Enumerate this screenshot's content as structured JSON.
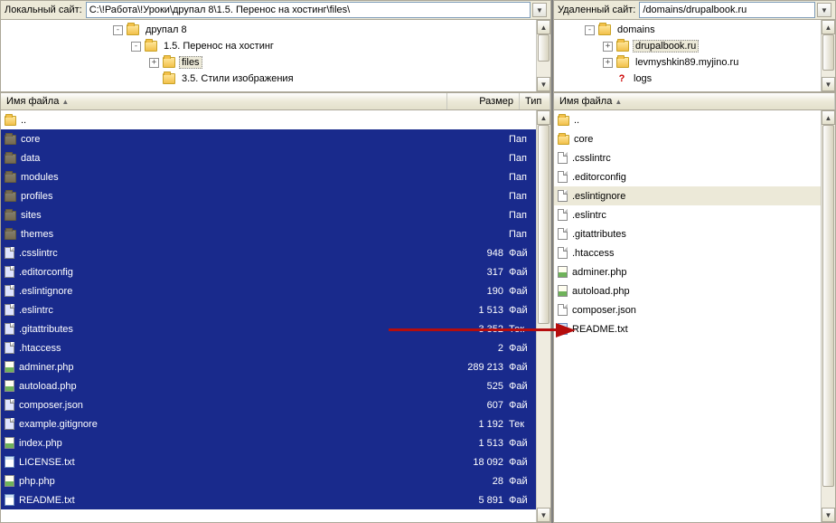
{
  "left": {
    "path_label": "Локальный сайт:",
    "path_value": "C:\\!Работа\\!Уроки\\друпал 8\\1.5. Перенос на хостинг\\files\\",
    "tree": [
      {
        "indent": 120,
        "toggle": "-",
        "icon": "folder",
        "label": "друпал 8",
        "selected": false
      },
      {
        "indent": 140,
        "toggle": "-",
        "icon": "folder",
        "label": "1.5. Перенос на хостинг",
        "selected": false
      },
      {
        "indent": 160,
        "toggle": "+",
        "icon": "folder",
        "label": "files",
        "selected": true
      },
      {
        "indent": 160,
        "toggle": " ",
        "icon": "folder",
        "label": "3.5. Стили изображения",
        "selected": false
      }
    ],
    "cols": {
      "name": "Имя файла",
      "size": "Размер",
      "type": "Тип"
    },
    "rows": [
      {
        "icon": "folder",
        "name": "..",
        "size": "",
        "type": "",
        "sel": false
      },
      {
        "icon": "folder",
        "name": "core",
        "size": "",
        "type": "Пап",
        "sel": true
      },
      {
        "icon": "folder",
        "name": "data",
        "size": "",
        "type": "Пап",
        "sel": true
      },
      {
        "icon": "folder",
        "name": "modules",
        "size": "",
        "type": "Пап",
        "sel": true
      },
      {
        "icon": "folder",
        "name": "profiles",
        "size": "",
        "type": "Пап",
        "sel": true
      },
      {
        "icon": "folder",
        "name": "sites",
        "size": "",
        "type": "Пап",
        "sel": true
      },
      {
        "icon": "folder",
        "name": "themes",
        "size": "",
        "type": "Пап",
        "sel": true
      },
      {
        "icon": "file",
        "name": ".csslintrc",
        "size": "948",
        "type": "Фай",
        "sel": true
      },
      {
        "icon": "file",
        "name": ".editorconfig",
        "size": "317",
        "type": "Фай",
        "sel": true
      },
      {
        "icon": "file",
        "name": ".eslintignore",
        "size": "190",
        "type": "Фай",
        "sel": true
      },
      {
        "icon": "file",
        "name": ".eslintrc",
        "size": "1 513",
        "type": "Фай",
        "sel": true
      },
      {
        "icon": "file",
        "name": ".gitattributes",
        "size": "3 352",
        "type": "Тек",
        "sel": true
      },
      {
        "icon": "file",
        "name": ".htaccess",
        "size": "2",
        "type": "Фай",
        "sel": true
      },
      {
        "icon": "php",
        "name": "adminer.php",
        "size": "289 213",
        "type": "Фай",
        "sel": true
      },
      {
        "icon": "php",
        "name": "autoload.php",
        "size": "525",
        "type": "Фай",
        "sel": true
      },
      {
        "icon": "file",
        "name": "composer.json",
        "size": "607",
        "type": "Фай",
        "sel": true
      },
      {
        "icon": "file",
        "name": "example.gitignore",
        "size": "1 192",
        "type": "Тек",
        "sel": true
      },
      {
        "icon": "php",
        "name": "index.php",
        "size": "1 513",
        "type": "Фай",
        "sel": true
      },
      {
        "icon": "txt",
        "name": "LICENSE.txt",
        "size": "18 092",
        "type": "Фай",
        "sel": true
      },
      {
        "icon": "php",
        "name": "php.php",
        "size": "28",
        "type": "Фай",
        "sel": true
      },
      {
        "icon": "txt",
        "name": "README.txt",
        "size": "5 891",
        "type": "Фай",
        "sel": true
      }
    ]
  },
  "right": {
    "path_label": "Удаленный сайт:",
    "path_value": "/domains/drupalbook.ru",
    "tree": [
      {
        "indent": 30,
        "toggle": "-",
        "icon": "folder",
        "label": "domains",
        "selected": false
      },
      {
        "indent": 50,
        "toggle": "+",
        "icon": "folder",
        "label": "drupalbook.ru",
        "selected": true
      },
      {
        "indent": 50,
        "toggle": "+",
        "icon": "folder",
        "label": "levmyshkin89.myjino.ru",
        "selected": false
      },
      {
        "indent": 50,
        "toggle": " ",
        "icon": "q",
        "label": "logs",
        "selected": false
      }
    ],
    "cols": {
      "name": "Имя файла"
    },
    "rows": [
      {
        "icon": "folder",
        "name": "..",
        "sel": false
      },
      {
        "icon": "folder",
        "name": "core",
        "sel": false
      },
      {
        "icon": "file",
        "name": ".csslintrc",
        "sel": false
      },
      {
        "icon": "file",
        "name": ".editorconfig",
        "sel": false
      },
      {
        "icon": "file",
        "name": ".eslintignore",
        "sel": "grey"
      },
      {
        "icon": "file",
        "name": ".eslintrc",
        "sel": false
      },
      {
        "icon": "file",
        "name": ".gitattributes",
        "sel": false
      },
      {
        "icon": "file",
        "name": ".htaccess",
        "sel": false
      },
      {
        "icon": "php",
        "name": "adminer.php",
        "sel": false
      },
      {
        "icon": "php",
        "name": "autoload.php",
        "sel": false
      },
      {
        "icon": "file",
        "name": "composer.json",
        "sel": false
      },
      {
        "icon": "txt",
        "name": "README.txt",
        "sel": false
      }
    ]
  }
}
